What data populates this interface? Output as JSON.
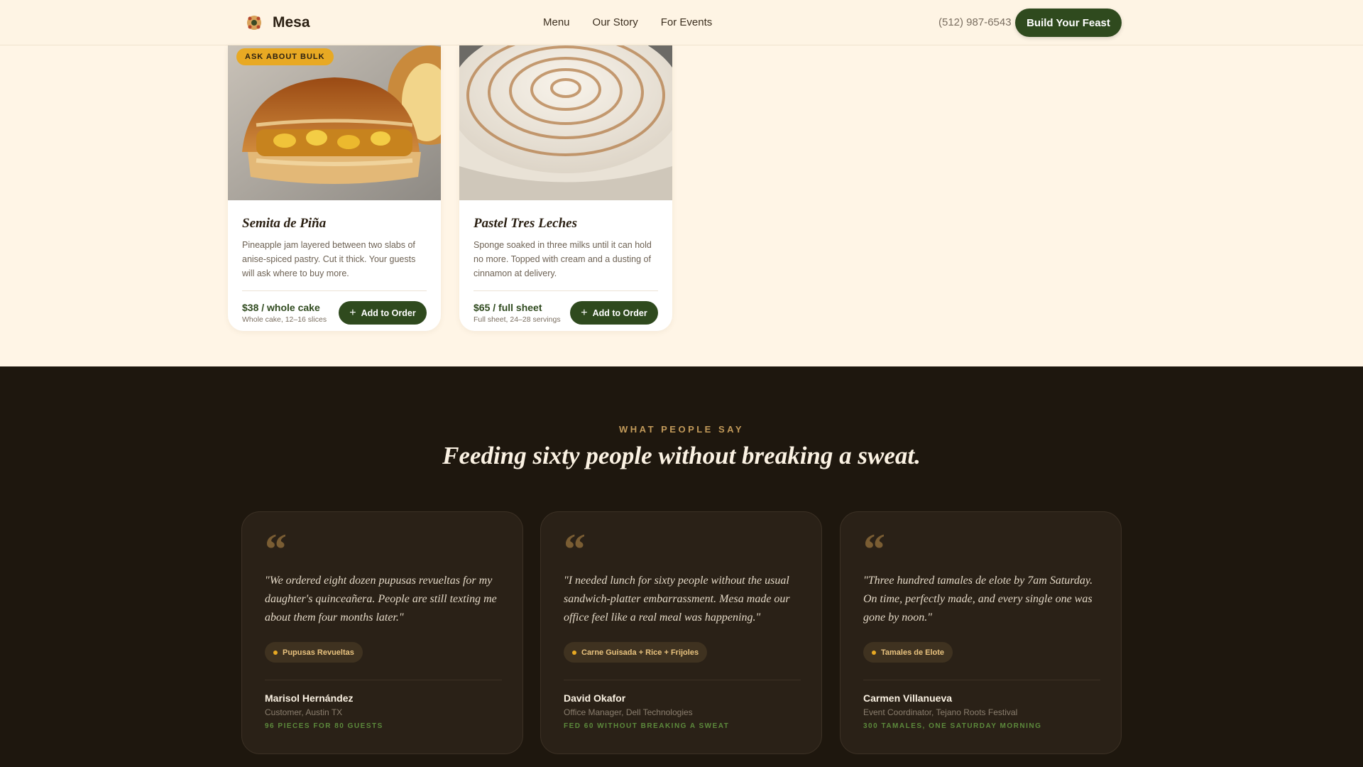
{
  "header": {
    "brand": "Mesa",
    "nav": [
      "Menu",
      "Our Story",
      "For Events"
    ],
    "phone": "(512) 987-6543",
    "cta": "Build Your Feast"
  },
  "products": [
    {
      "badge": "ASK ABOUT BULK",
      "title": "Semita de Piña",
      "description": "Pineapple jam layered between two slabs of anise-spiced pastry. Cut it thick. Your guests will ask where to buy more.",
      "price": "$38 / whole cake",
      "price_sub": "Whole cake, 12–16 slices",
      "button": "Add to Order"
    },
    {
      "title": "Pastel Tres Leches",
      "description": "Sponge soaked in three milks until it can hold no more. Topped with cream and a dusting of cinnamon at delivery.",
      "price": "$65 / full sheet",
      "price_sub": "Full sheet, 24–28 servings",
      "button": "Add to Order"
    }
  ],
  "testimonials": {
    "eyebrow": "WHAT PEOPLE SAY",
    "headline": "Feeding sixty people without breaking a sweat.",
    "items": [
      {
        "quote": "\"We ordered eight dozen pupusas revueltas for my daughter's quinceañera. People are still texting me about them four months later.\"",
        "dish": "Pupusas Revueltas",
        "name": "Marisol Hernández",
        "role": "Customer, Austin TX",
        "stat": "96 PIECES FOR 80 GUESTS"
      },
      {
        "quote": "\"I needed lunch for sixty people without the usual sandwich-platter embarrassment. Mesa made our office feel like a real meal was happening.\"",
        "dish": "Carne Guisada + Rice + Frijoles",
        "name": "David Okafor",
        "role": "Office Manager, Dell Technologies",
        "stat": "FED 60 WITHOUT BREAKING A SWEAT"
      },
      {
        "quote": "\"Three hundred tamales de elote by 7am Saturday. On time, perfectly made, and every single one was gone by noon.\"",
        "dish": "Tamales de Elote",
        "name": "Carmen Villanueva",
        "role": "Event Coordinator, Tejano Roots Festival",
        "stat": "300 TAMALES, ONE SATURDAY MORNING"
      }
    ]
  },
  "colors": {
    "brand_green": "#2f4a1e",
    "accent_gold": "#e8a923",
    "dark_bg": "#1e170e",
    "cream_bg": "#fff5e6"
  }
}
